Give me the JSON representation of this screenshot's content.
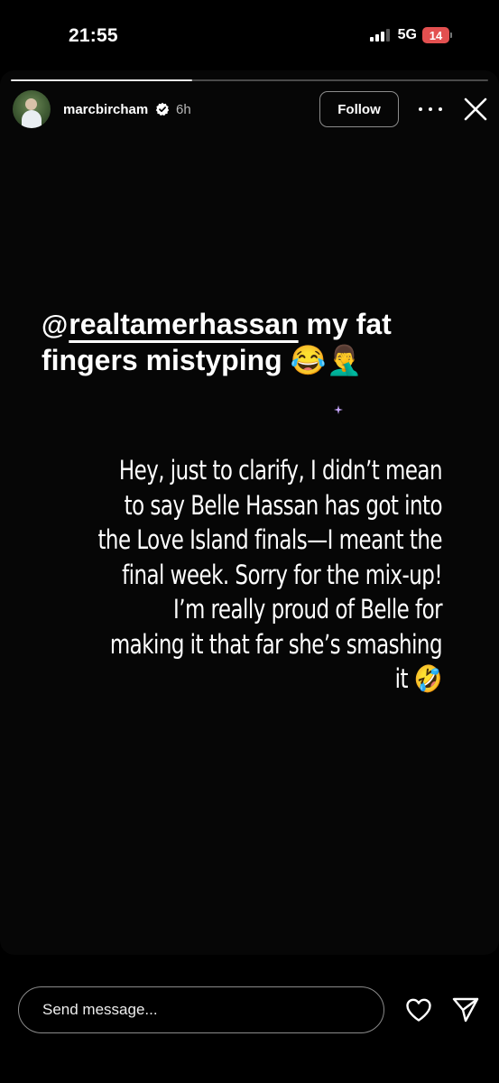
{
  "status_bar": {
    "time": "21:55",
    "network": "5G",
    "battery": "14"
  },
  "story": {
    "progress_fraction": 0.38,
    "username": "marcbircham",
    "time_ago": "6h",
    "follow_label": "Follow",
    "caption": {
      "mention": "realtamerhassan",
      "text_line1": " my fat",
      "text_line2": "fingers mistyping 😂🤦‍♂️"
    },
    "body_lines": [
      "Hey, just to clarify, I didn’t mean",
      "to say Belle Hassan has got into",
      "the Love Island finals—I meant the",
      "final week. Sorry for the mix-up!",
      "I’m really proud of Belle for",
      "making it that far she’s smashing",
      "it 🤣"
    ]
  },
  "bottom_bar": {
    "message_placeholder": "Send message..."
  },
  "icons": {
    "threads": "threads-icon",
    "verified": "verified-badge-icon",
    "more": "more-icon",
    "close": "close-icon",
    "heart": "heart-icon",
    "send": "send-icon"
  },
  "colors": {
    "battery_low": "#e35050",
    "verified": "#ffffff",
    "background": "#000000"
  }
}
